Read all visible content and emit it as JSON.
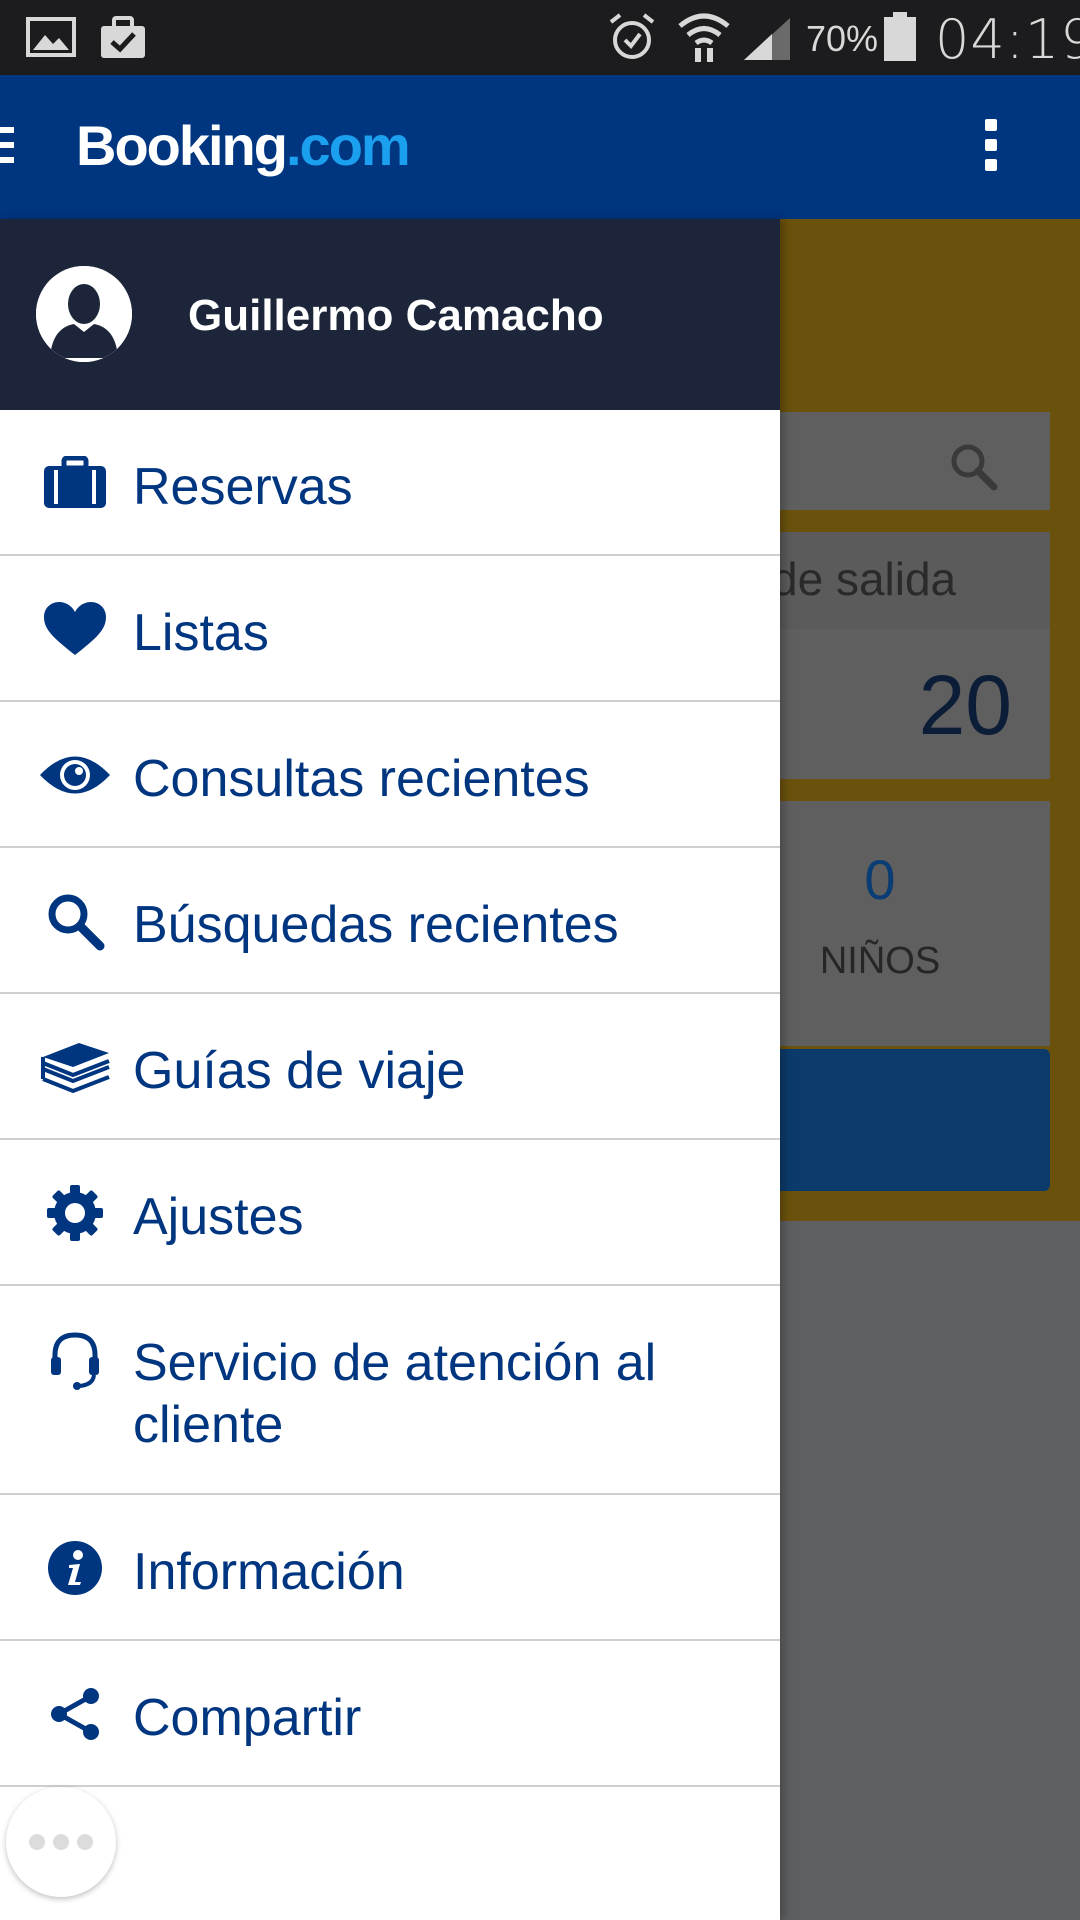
{
  "status_bar": {
    "battery_percent": "70%",
    "time": "04:19",
    "icons": [
      "gallery-icon",
      "task-icon",
      "alarm-icon",
      "wifi-icon",
      "signal-icon",
      "battery-icon"
    ]
  },
  "app_bar": {
    "brand_main": "Booking",
    "brand_suffix": ".com",
    "icons": [
      "hamburger-icon",
      "overflow-menu-icon"
    ]
  },
  "colors": {
    "primary": "#003580",
    "brand_light_blue": "#1ba0f0",
    "drawer_header": "#1c2539"
  },
  "drawer": {
    "user_name": "Guillermo Camacho",
    "items": [
      {
        "label": "Reservas",
        "icon": "briefcase-icon"
      },
      {
        "label": "Listas",
        "icon": "heart-icon"
      },
      {
        "label": "Consultas recientes",
        "icon": "eye-icon"
      },
      {
        "label": "Búsquedas recientes",
        "icon": "search-icon"
      },
      {
        "label": "Guías de viaje",
        "icon": "books-icon"
      },
      {
        "label": "Ajustes",
        "icon": "gear-icon"
      },
      {
        "label": "Servicio de atención al cliente",
        "icon": "headset-icon"
      },
      {
        "label": "Información",
        "icon": "info-icon"
      },
      {
        "label": "Compartir",
        "icon": "share-icon"
      }
    ]
  },
  "background": {
    "date_header": "de salida",
    "date_value": "20",
    "kids_count": "0",
    "kids_label": "NIÑOS"
  }
}
